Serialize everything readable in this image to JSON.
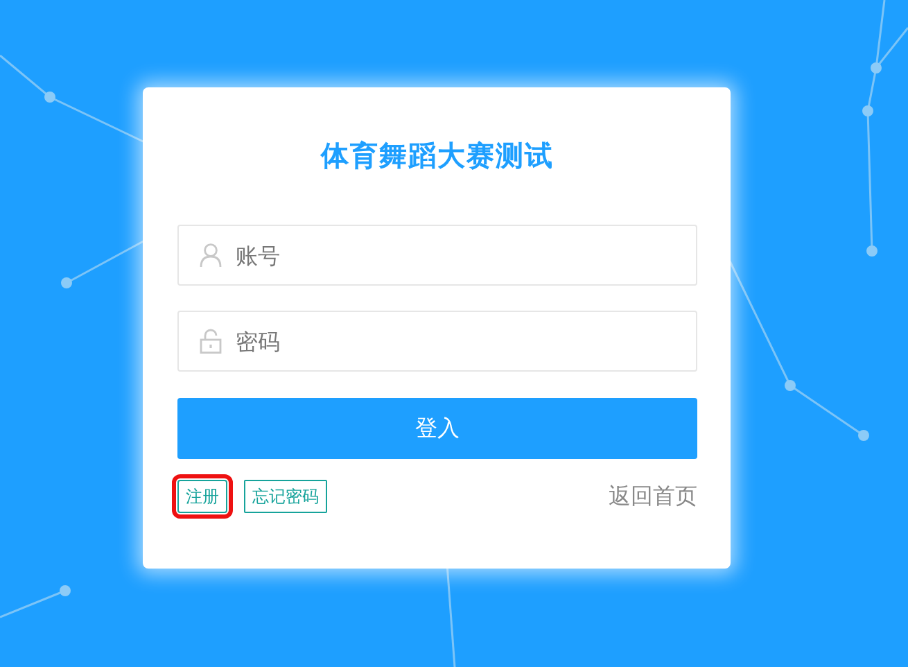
{
  "title": "体育舞蹈大赛测试",
  "fields": [
    {
      "kind": "user",
      "placeholder": "账号"
    },
    {
      "kind": "password",
      "placeholder": "密码"
    }
  ],
  "login_button": "登入",
  "links": [
    {
      "label": "注册",
      "highlighted": true
    },
    {
      "label": "忘记密码",
      "highlighted": false
    }
  ],
  "home_link": "返回首页"
}
